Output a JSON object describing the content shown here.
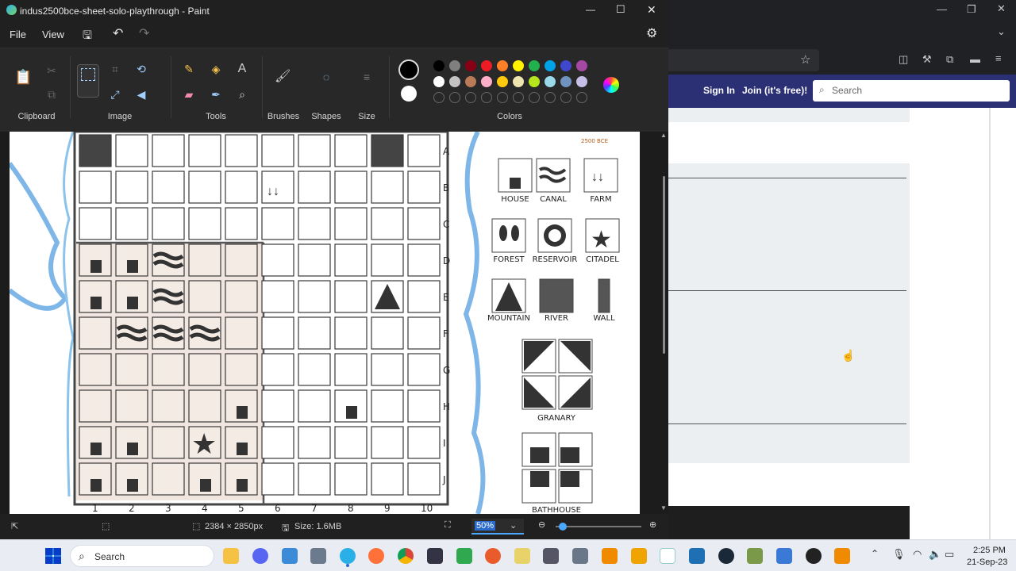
{
  "paint": {
    "title": "indus2500bce-sheet-solo-playthrough - Paint",
    "menu": {
      "file": "File",
      "view": "View"
    },
    "groups": {
      "clipboard": "Clipboard",
      "image": "Image",
      "tools": "Tools",
      "brushes": "Brushes",
      "shapes": "Shapes",
      "size": "Size",
      "colors": "Colors"
    },
    "palette_row1": [
      "#000000",
      "#7f7f7f",
      "#880015",
      "#ed1c24",
      "#ff7f27",
      "#fff200",
      "#22b14c",
      "#00a2e8",
      "#3f48cc",
      "#a349a4"
    ],
    "palette_row2": [
      "#ffffff",
      "#c3c3c3",
      "#b97a57",
      "#ffaec9",
      "#ffc90e",
      "#efe4b0",
      "#b5e61d",
      "#99d9ea",
      "#7092be",
      "#c8bfe7"
    ],
    "status": {
      "dimensions": "2384 × 2850px",
      "size": "Size: 1.6MB",
      "zoom": "50%"
    }
  },
  "sheet": {
    "rows": [
      "A",
      "B",
      "C",
      "D",
      "E",
      "F",
      "G",
      "H",
      "I",
      "J"
    ],
    "cols": [
      "1",
      "2",
      "3",
      "4",
      "5",
      "6",
      "7",
      "8",
      "9",
      "10"
    ],
    "badge": "2500 BCE",
    "legend": [
      "HOUSE",
      "CANAL",
      "FARM",
      "FOREST",
      "RESERVOIR",
      "CITADEL",
      "MOUNTAIN",
      "RIVER",
      "WALL",
      "GRANARY",
      "BATHHOUSE"
    ]
  },
  "browser": {
    "sign_in": "Sign In",
    "join": "Join (it's free)!",
    "search_placeholder": "Search"
  },
  "taskbar": {
    "search": "Search",
    "time": "2:25 PM",
    "date": "21-Sep-23"
  }
}
